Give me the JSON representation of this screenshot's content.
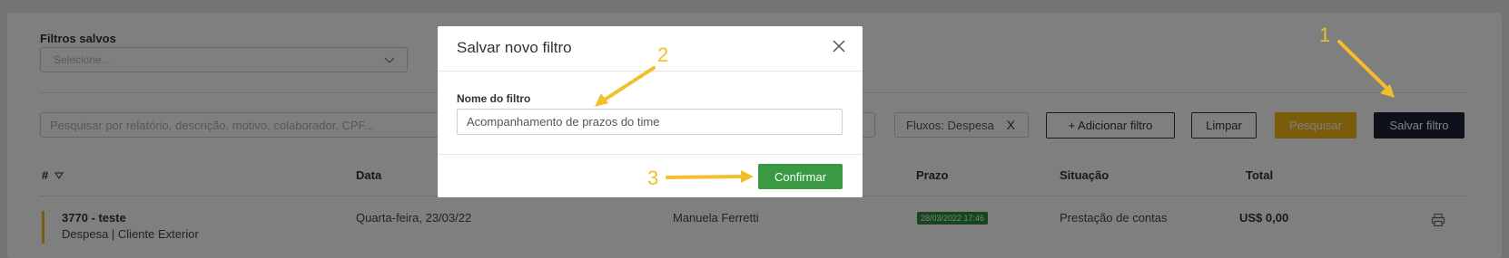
{
  "filters": {
    "saved_label": "Filtros salvos",
    "saved_placeholder": "Selecione...",
    "search_placeholder": "Pesquisar por relatório, descrição, motivo, colaborador, CPF...",
    "chip_label": "Fluxos: Despesa",
    "chip_remove": "X"
  },
  "toolbar": {
    "add_filter": "+ Adicionar filtro",
    "clear": "Limpar",
    "search": "Pesquisar",
    "save_filter": "Salvar filtro"
  },
  "table": {
    "headers": [
      "#",
      "Data",
      "Prazo",
      "Situação",
      "Total"
    ],
    "rows": [
      {
        "id_title": "3770 - teste",
        "subtitle": "Despesa | Cliente Exterior",
        "date": "Quarta-feira, 23/03/22",
        "collaborator": "Manuela Ferretti",
        "deadline": "28/03/2022 17:46",
        "status": "Prestação de contas",
        "total": "US$ 0,00"
      }
    ]
  },
  "modal": {
    "title": "Salvar novo filtro",
    "field_label": "Nome do filtro",
    "field_value": "Acompanhamento de prazos do time",
    "confirm": "Confirmar"
  },
  "annotations": {
    "step1": "1",
    "step2": "2",
    "step3": "3",
    "color": "#f4bd2a"
  },
  "colors": {
    "save_button": "#1e2235",
    "search_button": "#f4b916",
    "confirm_button": "#3a9a44",
    "deadline_badge": "#2e8b3a"
  }
}
